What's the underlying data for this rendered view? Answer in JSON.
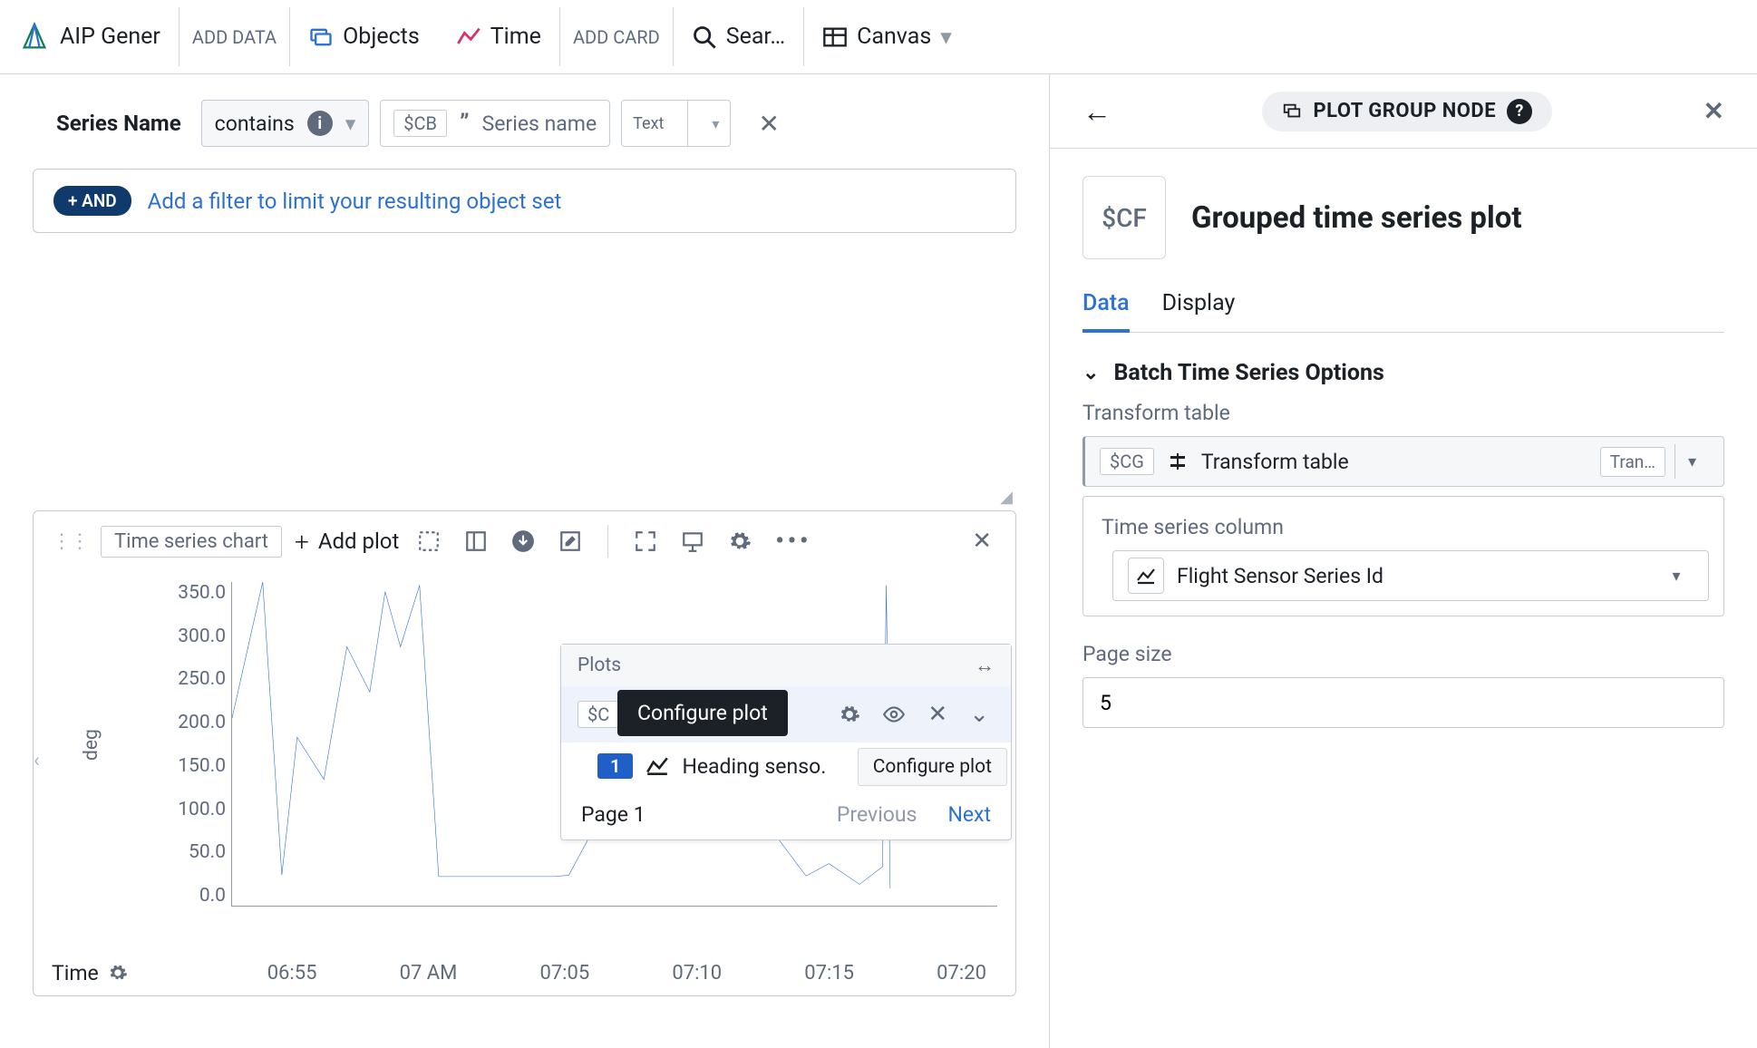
{
  "topbar": {
    "app_name": "AIP Gener",
    "add_data": "ADD DATA",
    "objects": "Objects",
    "time": "Time",
    "add_card": "ADD CARD",
    "search": "Sear…",
    "canvas": "Canvas"
  },
  "filter": {
    "field_label": "Series Name",
    "operator": "contains",
    "value_var": "$CB",
    "value_placeholder": "Series name",
    "value_type": "Text",
    "add_and": "+ AND",
    "add_filter": "Add a filter to limit your resulting object set"
  },
  "chart_card": {
    "name": "Time series chart",
    "add_plot": "Add plot",
    "time_label": "Time"
  },
  "plots_popover": {
    "title": "Plots",
    "var": "$C",
    "tooltip": "Configure plot",
    "row_tooltip": "Configure plot",
    "series_index": "1",
    "series_name": "Heading senso.",
    "page_label": "Page 1",
    "prev": "Previous",
    "next": "Next"
  },
  "right_panel": {
    "back": "←",
    "node_label": "PLOT GROUP NODE",
    "cf_var": "$CF",
    "title": "Grouped time series plot",
    "tab_data": "Data",
    "tab_display": "Display",
    "section": "Batch Time Series Options",
    "transform_label": "Transform table",
    "transform_var": "$CG",
    "transform_value": "Transform table",
    "transform_btn": "Tran…",
    "ts_col_label": "Time series column",
    "ts_col_value": "Flight Sensor Series Id",
    "page_size_label": "Page size",
    "page_size_value": "5"
  },
  "chart_data": {
    "type": "line",
    "ylabel": "deg",
    "ylim": [
      0,
      350
    ],
    "y_ticks": [
      "350.0",
      "300.0",
      "250.0",
      "200.0",
      "150.0",
      "100.0",
      "50.0",
      "0.0"
    ],
    "categories": [
      "06:55",
      "07 AM",
      "07:05",
      "07:10",
      "07:15",
      "07:20"
    ],
    "series": [
      {
        "name": "Heading sensor",
        "points": [
          [
            0.0,
            0.58
          ],
          [
            0.04,
            1.0
          ],
          [
            0.065,
            0.095
          ],
          [
            0.085,
            0.52
          ],
          [
            0.12,
            0.39
          ],
          [
            0.15,
            0.8
          ],
          [
            0.18,
            0.66
          ],
          [
            0.2,
            0.97
          ],
          [
            0.22,
            0.8
          ],
          [
            0.245,
            0.99
          ],
          [
            0.27,
            0.09
          ],
          [
            0.42,
            0.09
          ],
          [
            0.44,
            0.094
          ],
          [
            0.53,
            0.49
          ],
          [
            0.57,
            0.66
          ],
          [
            0.75,
            0.092
          ],
          [
            0.78,
            0.13
          ],
          [
            0.82,
            0.066
          ],
          [
            0.85,
            0.12
          ],
          [
            0.855,
            0.99
          ],
          [
            0.86,
            0.054
          ]
        ]
      }
    ]
  }
}
